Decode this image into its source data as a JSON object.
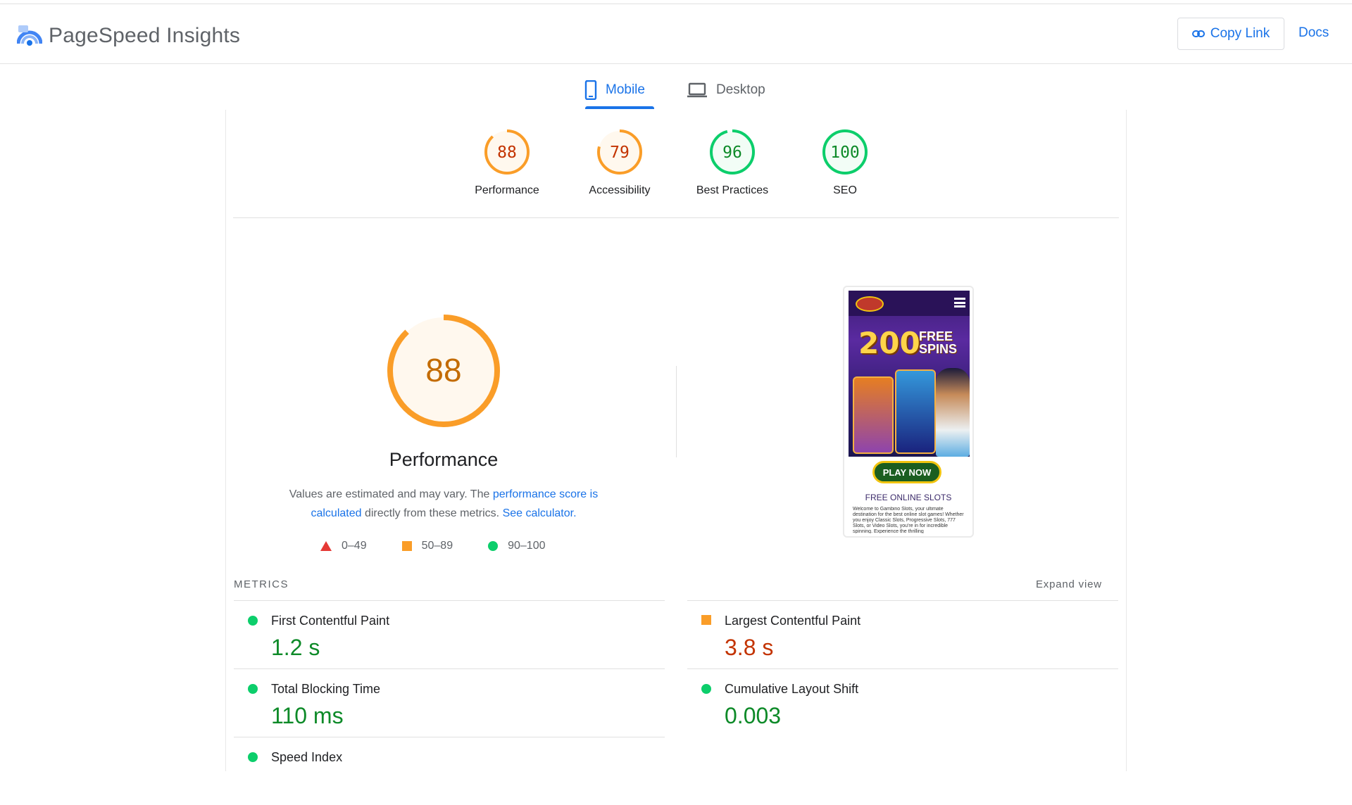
{
  "header": {
    "brand": "PageSpeed Insights",
    "copy_link": "Copy Link",
    "docs": "Docs"
  },
  "tabs": [
    {
      "label": "Mobile",
      "selected": true
    },
    {
      "label": "Desktop",
      "selected": false
    }
  ],
  "scores": [
    {
      "value": "88",
      "label": "Performance",
      "color": "#fa9d28",
      "text_color": "#c33300",
      "fill": 0.88
    },
    {
      "value": "79",
      "label": "Accessibility",
      "color": "#fa9d28",
      "text_color": "#c33300",
      "fill": 0.79
    },
    {
      "value": "96",
      "label": "Best Practices",
      "color": "#0cce6b",
      "text_color": "#0d8a28",
      "fill": 0.96
    },
    {
      "value": "100",
      "label": "SEO",
      "color": "#0cce6b",
      "text_color": "#0d8a28",
      "fill": 1.0
    }
  ],
  "performance": {
    "score": "88",
    "fill": 0.88,
    "title": "Performance",
    "desc_prefix": "Values are estimated and may vary. The ",
    "link1": "performance score is calculated",
    "desc_mid": " directly from these metrics. ",
    "link2": "See calculator.",
    "legend": [
      "0–49",
      "50–89",
      "90–100"
    ]
  },
  "screenshot": {
    "spins_number": "200",
    "spins_text_1": "FREE",
    "spins_text_2": "SPINS",
    "play_button": "PLAY NOW",
    "heading": "FREE ONLINE SLOTS",
    "body": "Welcome to Gambino Slots, your ultimate destination for the best online slot games! Whether you enjoy Classic Slots, Progressive Slots, 777 Slots, or Video Slots, you're in for incredible spinning. Experience the thrilling"
  },
  "metrics": {
    "label": "METRICS",
    "expand": "Expand view",
    "left": [
      {
        "name": "First Contentful Paint",
        "value": "1.2 s",
        "status": "good"
      },
      {
        "name": "Total Blocking Time",
        "value": "110 ms",
        "status": "good"
      },
      {
        "name": "Speed Index",
        "value": "",
        "status": "good"
      }
    ],
    "right": [
      {
        "name": "Largest Contentful Paint",
        "value": "3.8 s",
        "status": "average"
      },
      {
        "name": "Cumulative Layout Shift",
        "value": "0.003",
        "status": "good"
      }
    ]
  },
  "colors": {
    "accent": "#1a73e8",
    "good": "#0cce6b",
    "average": "#fa9d28",
    "poor": "#e53935"
  }
}
